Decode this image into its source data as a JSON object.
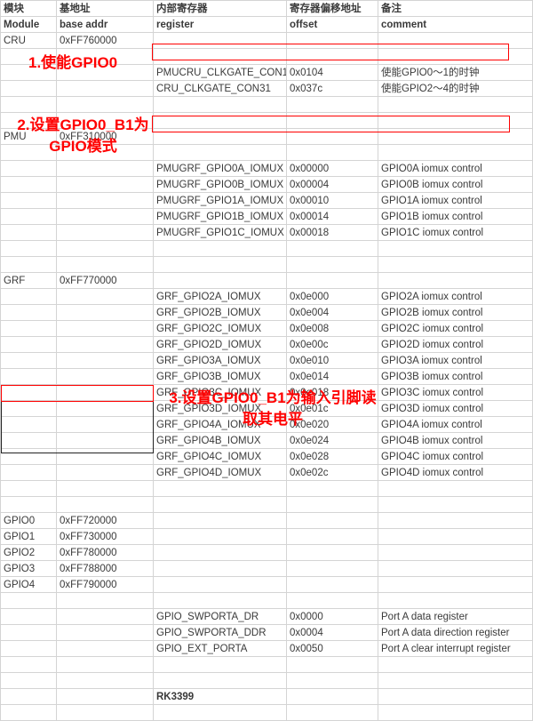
{
  "document": {
    "chip_label": "RK3399"
  },
  "columns": {
    "header_cn": [
      "模块",
      "基地址",
      "内部寄存器",
      "寄存器偏移地址",
      "备注"
    ],
    "header_en": [
      "Module",
      "base addr",
      "register",
      "offset",
      "comment"
    ]
  },
  "rows": [
    {
      "module": "CRU",
      "base": "0xFF760000",
      "register": "",
      "offset": "",
      "comment": ""
    },
    {
      "module": "",
      "base": "",
      "register": "",
      "offset": "",
      "comment": ""
    },
    {
      "module": "",
      "base": "",
      "register": "PMUCRU_CLKGATE_CON1",
      "offset": "0x0104",
      "comment": "使能GPIO0～1的时钟"
    },
    {
      "module": "",
      "base": "",
      "register": "CRU_CLKGATE_CON31",
      "offset": "0x037c",
      "comment": "使能GPIO2～4的时钟"
    },
    {
      "module": "",
      "base": "",
      "register": "",
      "offset": "",
      "comment": ""
    },
    {
      "module": "",
      "base": "",
      "register": "",
      "offset": "",
      "comment": ""
    },
    {
      "module": "PMU",
      "base": "0xFF310000",
      "register": "",
      "offset": "",
      "comment": ""
    },
    {
      "module": "",
      "base": "",
      "register": "",
      "offset": "",
      "comment": ""
    },
    {
      "module": "",
      "base": "",
      "register": "PMUGRF_GPIO0A_IOMUX",
      "offset": "0x00000",
      "comment": "GPIO0A iomux control"
    },
    {
      "module": "",
      "base": "",
      "register": "PMUGRF_GPIO0B_IOMUX",
      "offset": "0x00004",
      "comment": "GPIO0B iomux control"
    },
    {
      "module": "",
      "base": "",
      "register": "PMUGRF_GPIO1A_IOMUX",
      "offset": "0x00010",
      "comment": "GPIO1A iomux control"
    },
    {
      "module": "",
      "base": "",
      "register": "PMUGRF_GPIO1B_IOMUX",
      "offset": "0x00014",
      "comment": "GPIO1B iomux control"
    },
    {
      "module": "",
      "base": "",
      "register": "PMUGRF_GPIO1C_IOMUX",
      "offset": "0x00018",
      "comment": "GPIO1C iomux control"
    },
    {
      "module": "",
      "base": "",
      "register": "",
      "offset": "",
      "comment": ""
    },
    {
      "module": "",
      "base": "",
      "register": "",
      "offset": "",
      "comment": ""
    },
    {
      "module": "GRF",
      "base": "0xFF770000",
      "register": "",
      "offset": "",
      "comment": ""
    },
    {
      "module": "",
      "base": "",
      "register": "GRF_GPIO2A_IOMUX",
      "offset": "0x0e000",
      "comment": "GPIO2A iomux control"
    },
    {
      "module": "",
      "base": "",
      "register": "GRF_GPIO2B_IOMUX",
      "offset": "0x0e004",
      "comment": "GPIO2B iomux control"
    },
    {
      "module": "",
      "base": "",
      "register": "GRF_GPIO2C_IOMUX",
      "offset": "0x0e008",
      "comment": "GPIO2C iomux control"
    },
    {
      "module": "",
      "base": "",
      "register": "GRF_GPIO2D_IOMUX",
      "offset": "0x0e00c",
      "comment": "GPIO2D iomux control"
    },
    {
      "module": "",
      "base": "",
      "register": "GRF_GPIO3A_IOMUX",
      "offset": "0x0e010",
      "comment": "GPIO3A iomux control"
    },
    {
      "module": "",
      "base": "",
      "register": "GRF_GPIO3B_IOMUX",
      "offset": "0x0e014",
      "comment": "GPIO3B iomux control"
    },
    {
      "module": "",
      "base": "",
      "register": "GRF_GPIO3C_IOMUX",
      "offset": "0x0e018",
      "comment": "GPIO3C iomux control"
    },
    {
      "module": "",
      "base": "",
      "register": "GRF_GPIO3D_IOMUX",
      "offset": "0x0e01c",
      "comment": "GPIO3D iomux control"
    },
    {
      "module": "",
      "base": "",
      "register": "GRF_GPIO4A_IOMUX",
      "offset": "0x0e020",
      "comment": "GPIO4A iomux control"
    },
    {
      "module": "",
      "base": "",
      "register": "GRF_GPIO4B_IOMUX",
      "offset": "0x0e024",
      "comment": "GPIO4B iomux control"
    },
    {
      "module": "",
      "base": "",
      "register": "GRF_GPIO4C_IOMUX",
      "offset": "0x0e028",
      "comment": "GPIO4C iomux control"
    },
    {
      "module": "",
      "base": "",
      "register": "GRF_GPIO4D_IOMUX",
      "offset": "0x0e02c",
      "comment": "GPIO4D iomux control"
    },
    {
      "module": "",
      "base": "",
      "register": "",
      "offset": "",
      "comment": ""
    },
    {
      "module": "",
      "base": "",
      "register": "",
      "offset": "",
      "comment": ""
    },
    {
      "module": "GPIO0",
      "base": "0xFF720000",
      "register": "",
      "offset": "",
      "comment": ""
    },
    {
      "module": "GPIO1",
      "base": "0xFF730000",
      "register": "",
      "offset": "",
      "comment": ""
    },
    {
      "module": "GPIO2",
      "base": "0xFF780000",
      "register": "",
      "offset": "",
      "comment": ""
    },
    {
      "module": "GPIO3",
      "base": "0xFF788000",
      "register": "",
      "offset": "",
      "comment": ""
    },
    {
      "module": "GPIO4",
      "base": "0xFF790000",
      "register": "",
      "offset": "",
      "comment": ""
    },
    {
      "module": "",
      "base": "",
      "register": "",
      "offset": "",
      "comment": ""
    },
    {
      "module": "",
      "base": "",
      "register": "GPIO_SWPORTA_DR",
      "offset": "0x0000",
      "comment": "Port A data register"
    },
    {
      "module": "",
      "base": "",
      "register": "GPIO_SWPORTA_DDR",
      "offset": "0x0004",
      "comment": "Port A data direction register"
    },
    {
      "module": "",
      "base": "",
      "register": "GPIO_EXT_PORTA",
      "offset": "0x0050",
      "comment": "Port A clear interrupt register"
    },
    {
      "module": "",
      "base": "",
      "register": "",
      "offset": "",
      "comment": ""
    },
    {
      "module": "",
      "base": "",
      "register": "",
      "offset": "",
      "comment": ""
    },
    {
      "module": "",
      "base": "",
      "register": "RK3399",
      "offset": "",
      "comment": "",
      "big": true
    },
    {
      "module": "",
      "base": "",
      "register": "",
      "offset": "",
      "comment": ""
    }
  ],
  "annotations": [
    {
      "id": "step-1",
      "text": "1.使能GPIO0"
    },
    {
      "id": "step-2",
      "text": "2.设置GPIO0_B1为GPIO模式"
    },
    {
      "id": "step-3",
      "text": "3.设置GPIO0_B1为输入引脚读取其电平"
    }
  ],
  "highlight_boxes": [
    {
      "id": "clkgate-highlight",
      "color": "#ff0000"
    },
    {
      "id": "iomux-highlight",
      "color": "#ff0000"
    },
    {
      "id": "gpio0-highlight",
      "color": "#ff0000"
    },
    {
      "id": "gpio-list-outline",
      "color": "#222222"
    }
  ]
}
